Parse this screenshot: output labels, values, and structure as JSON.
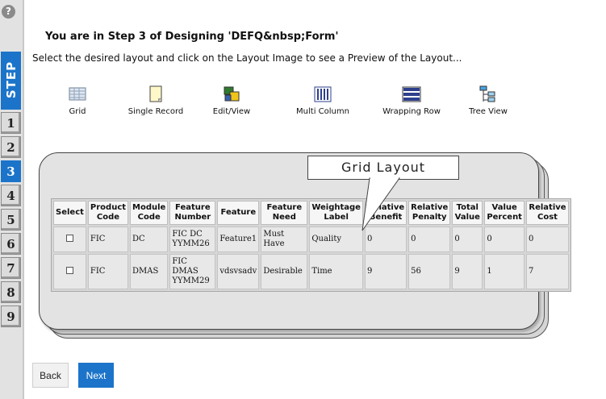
{
  "help": {
    "glyph": "?"
  },
  "steps": {
    "label": "STEP",
    "numbers": [
      "1",
      "2",
      "3",
      "4",
      "5",
      "6",
      "7",
      "8",
      "9"
    ],
    "active": "3"
  },
  "header": {
    "title": "You are in Step 3 of Designing 'DEFQ&nbsp;Form'",
    "instruction": "Select the desired layout and click on the Layout Image to see a Preview of the Layout..."
  },
  "layouts": [
    {
      "label": "Grid",
      "icon": "grid-icon"
    },
    {
      "label": "Single Record",
      "icon": "single-record-icon"
    },
    {
      "label": "Edit/View",
      "icon": "edit-view-icon"
    },
    {
      "label": "Multi Column",
      "icon": "multi-column-icon"
    },
    {
      "label": "Wrapping Row",
      "icon": "wrapping-row-icon"
    },
    {
      "label": "Tree View",
      "icon": "tree-view-icon"
    }
  ],
  "preview": {
    "callout": "Grid Layout",
    "headers": [
      [
        "Select"
      ],
      [
        "Product",
        "Code"
      ],
      [
        "Module",
        "Code"
      ],
      [
        "Feature",
        "Number"
      ],
      [
        "Feature"
      ],
      [
        "Feature",
        "Need"
      ],
      [
        "Weightage",
        "Label"
      ],
      [
        "Relative",
        "Benefit"
      ],
      [
        "Relative",
        "Penalty"
      ],
      [
        "Total",
        "Value"
      ],
      [
        "Value",
        "Percent"
      ],
      [
        "Relative",
        "Cost"
      ]
    ],
    "rows": [
      [
        "",
        "FIC",
        "DC",
        "FIC DC YYMM26",
        "Feature1",
        "Must Have",
        "Quality",
        "0",
        "0",
        "0",
        "0",
        "0"
      ],
      [
        "",
        "FIC",
        "DMAS",
        "FIC DMAS YYMM29",
        "vdsvsadv",
        "Desirable",
        "Time",
        "9",
        "56",
        "9",
        "1",
        "7"
      ]
    ]
  },
  "buttons": {
    "back": "Back",
    "next": "Next"
  },
  "colors": {
    "accent": "#1b74c9"
  }
}
